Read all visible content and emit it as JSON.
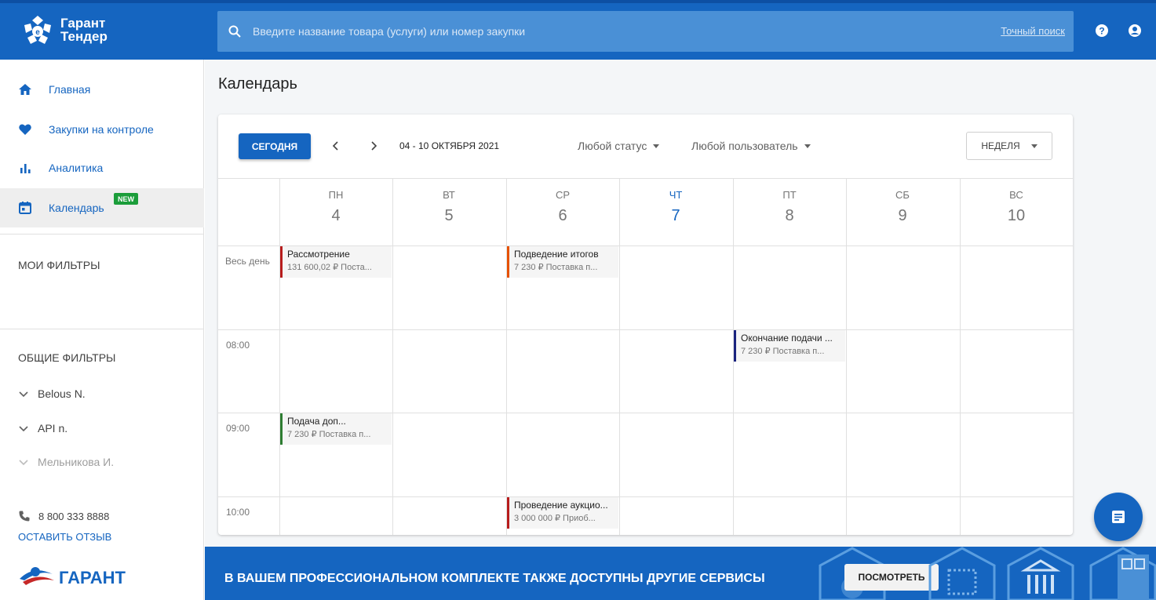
{
  "app": {
    "logo_line1": "Гарант",
    "logo_line2": "Тендер"
  },
  "search": {
    "placeholder": "Введите название товара (услуги) или номер закупки",
    "exact_link": "Точный поиск"
  },
  "header_icons": [
    "help-icon",
    "account-icon"
  ],
  "sidebar": {
    "items": [
      {
        "label": "Главная",
        "icon": "home-icon"
      },
      {
        "label": "Закупки на контроле",
        "icon": "heart-icon"
      },
      {
        "label": "Аналитика",
        "icon": "bar-chart-icon"
      },
      {
        "label": "Календарь",
        "icon": "calendar-icon",
        "active": true,
        "badge": "NEW"
      }
    ],
    "my_filters_title": "МОИ ФИЛЬТРЫ",
    "common_filters_title": "ОБЩИЕ ФИЛЬТРЫ",
    "filters": [
      {
        "label": "Belous N."
      },
      {
        "label": "API n."
      },
      {
        "label": "Мельникова И.",
        "muted": true
      }
    ],
    "phone": "8 800 333 8888",
    "feedback": "ОСТАВИТЬ ОТЗЫВ",
    "brand_logo_text": "ГАРАНТ"
  },
  "page": {
    "title": "Календарь"
  },
  "calendar": {
    "today_button": "СЕГОДНЯ",
    "range": "04 - 10 ОКТЯБРЯ 2021",
    "status_filter": "Любой статус",
    "user_filter": "Любой пользователь",
    "view_button": "НЕДЕЛЯ",
    "all_day_label": "Весь день",
    "days": [
      {
        "name": "ПН",
        "date": "4"
      },
      {
        "name": "ВТ",
        "date": "5"
      },
      {
        "name": "СР",
        "date": "6"
      },
      {
        "name": "ЧТ",
        "date": "7",
        "today": true
      },
      {
        "name": "ПТ",
        "date": "8"
      },
      {
        "name": "СБ",
        "date": "9"
      },
      {
        "name": "ВС",
        "date": "10"
      }
    ],
    "times": [
      "08:00",
      "09:00",
      "10:00"
    ],
    "events": [
      {
        "day": 0,
        "slot": "all-day",
        "title": "Рассмотрение",
        "subtitle": "131 600,02 ₽  Поста...",
        "color": "#b71c1c"
      },
      {
        "day": 2,
        "slot": "all-day",
        "title": "Подведение итогов",
        "subtitle": "7 230 ₽  Поставка п...",
        "color": "#e65100"
      },
      {
        "day": 4,
        "slot": "08:00",
        "title": "Окончание подачи ...",
        "subtitle": "7 230 ₽  Поставка п...",
        "color": "#1a237e"
      },
      {
        "day": 0,
        "slot": "09:00",
        "title": "Подача доп...",
        "subtitle": "7 230 ₽  Поставка п...",
        "color": "#2e7d32"
      },
      {
        "day": 2,
        "slot": "10:00",
        "title": "Проведение аукцио...",
        "subtitle": "3 000 000 ₽  Приоб...",
        "color": "#b71c1c"
      }
    ]
  },
  "promo": {
    "text": "В ВАШЕМ ПРОФЕССИОНАЛЬНОМ КОМПЛЕКТЕ ТАКЖЕ ДОСТУПНЫ ДРУГИЕ СЕРВИСЫ",
    "button": "ПОСМОТРЕТЬ"
  },
  "colors": {
    "brand_blue": "#1565c0",
    "search_bg": "#4a90d6",
    "badge_green": "#1b9d3a"
  }
}
